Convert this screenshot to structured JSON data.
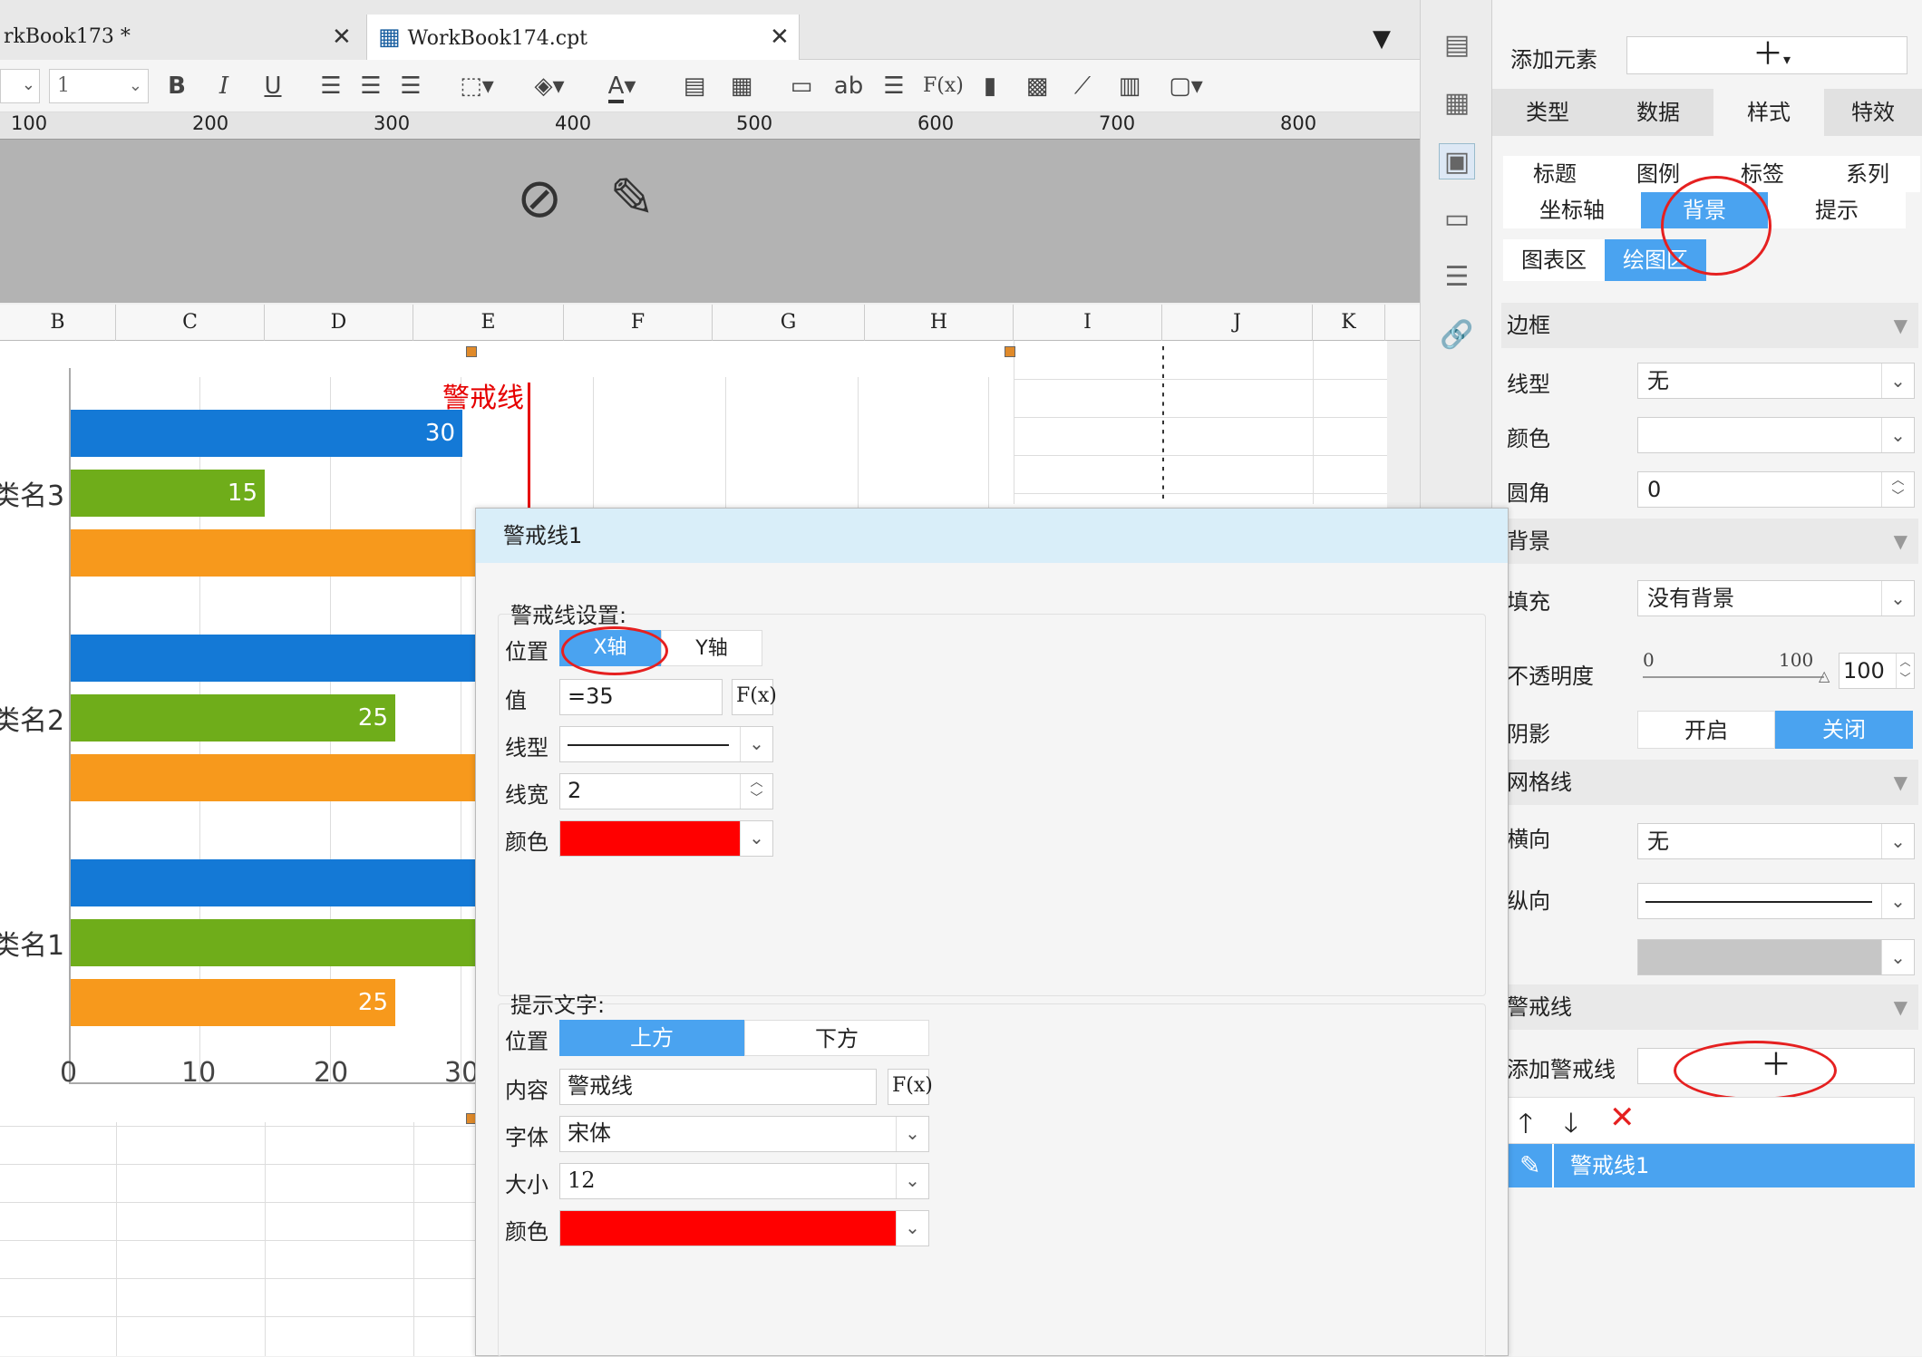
{
  "tabs": [
    {
      "label": "rkBook173 *"
    },
    {
      "label": "WorkBook174.cpt"
    }
  ],
  "toolbar": {
    "font_size_value": "1",
    "bold": "B",
    "italic": "I",
    "underline": "U",
    "text_tool": "ab",
    "formula": "F(x)"
  },
  "ruler": {
    "labels": [
      "100",
      "200",
      "300",
      "400",
      "500",
      "600",
      "700",
      "800"
    ]
  },
  "columns": [
    "B",
    "C",
    "D",
    "E",
    "F",
    "G",
    "H",
    "I",
    "J",
    "K"
  ],
  "chart": {
    "warning_label": "警戒线",
    "categories": [
      "类名3",
      "类名2",
      "类名1"
    ],
    "value_labels": [
      "30",
      "15",
      "25",
      "25"
    ],
    "x_ticks": [
      "0",
      "10",
      "20",
      "30"
    ]
  },
  "chart_data": {
    "type": "bar",
    "orientation": "horizontal",
    "categories": [
      "类名1",
      "类名2",
      "类名3"
    ],
    "series": [
      {
        "values": [
          null,
          null,
          30
        ],
        "color": "#1479d6"
      },
      {
        "values": [
          null,
          25,
          15
        ],
        "color": "#6fad1a"
      },
      {
        "values": [
          25,
          null,
          null
        ],
        "color": "#f7991c"
      }
    ],
    "x_ticks": [
      0,
      10,
      20,
      30
    ],
    "reference_line": {
      "axis": "x",
      "value": 35,
      "label": "警戒线",
      "color": "#e60000"
    }
  },
  "panel": {
    "add_element_label": "添加元素",
    "main_tabs": [
      "类型",
      "数据",
      "样式",
      "特效"
    ],
    "sub_tabs_row1": [
      "标题",
      "图例",
      "标签",
      "系列"
    ],
    "sub_tabs_row2": [
      "坐标轴",
      "背景",
      "提示"
    ],
    "sub_tabs_row3": [
      "图表区",
      "绘图区"
    ],
    "border_section": "边框",
    "line_type_label": "线型",
    "line_type_value": "无",
    "color_label": "颜色",
    "radius_label": "圆角",
    "radius_value": "0",
    "bg_section": "背景",
    "fill_label": "填充",
    "fill_value": "没有背景",
    "opacity_label": "不透明度",
    "opacity_min": "0",
    "opacity_max": "100",
    "opacity_value": "100",
    "shadow_label": "阴影",
    "shadow_on": "开启",
    "shadow_off": "关闭",
    "grid_section": "网格线",
    "horizontal_label": "横向",
    "horizontal_value": "无",
    "vertical_label": "纵向",
    "warning_section": "警戒线",
    "add_warning_label": "添加警戒线",
    "warning_item": "警戒线1"
  },
  "dialog": {
    "title": "警戒线1",
    "settings_label": "警戒线设置:",
    "position_label": "位置",
    "pos_x": "X轴",
    "pos_y": "Y轴",
    "value_label": "值",
    "value": "=35",
    "line_type_label": "线型",
    "line_width_label": "线宽",
    "line_width": "2",
    "color_label": "颜色",
    "hint_label": "提示文字:",
    "hint_position_label": "位置",
    "hint_above": "上方",
    "hint_below": "下方",
    "content_label": "内容",
    "content_value": "警戒线",
    "font_label": "字体",
    "font_value": "宋体",
    "size_label": "大小",
    "size_value": "12",
    "hint_color_label": "颜色",
    "fx": "F(x)"
  }
}
